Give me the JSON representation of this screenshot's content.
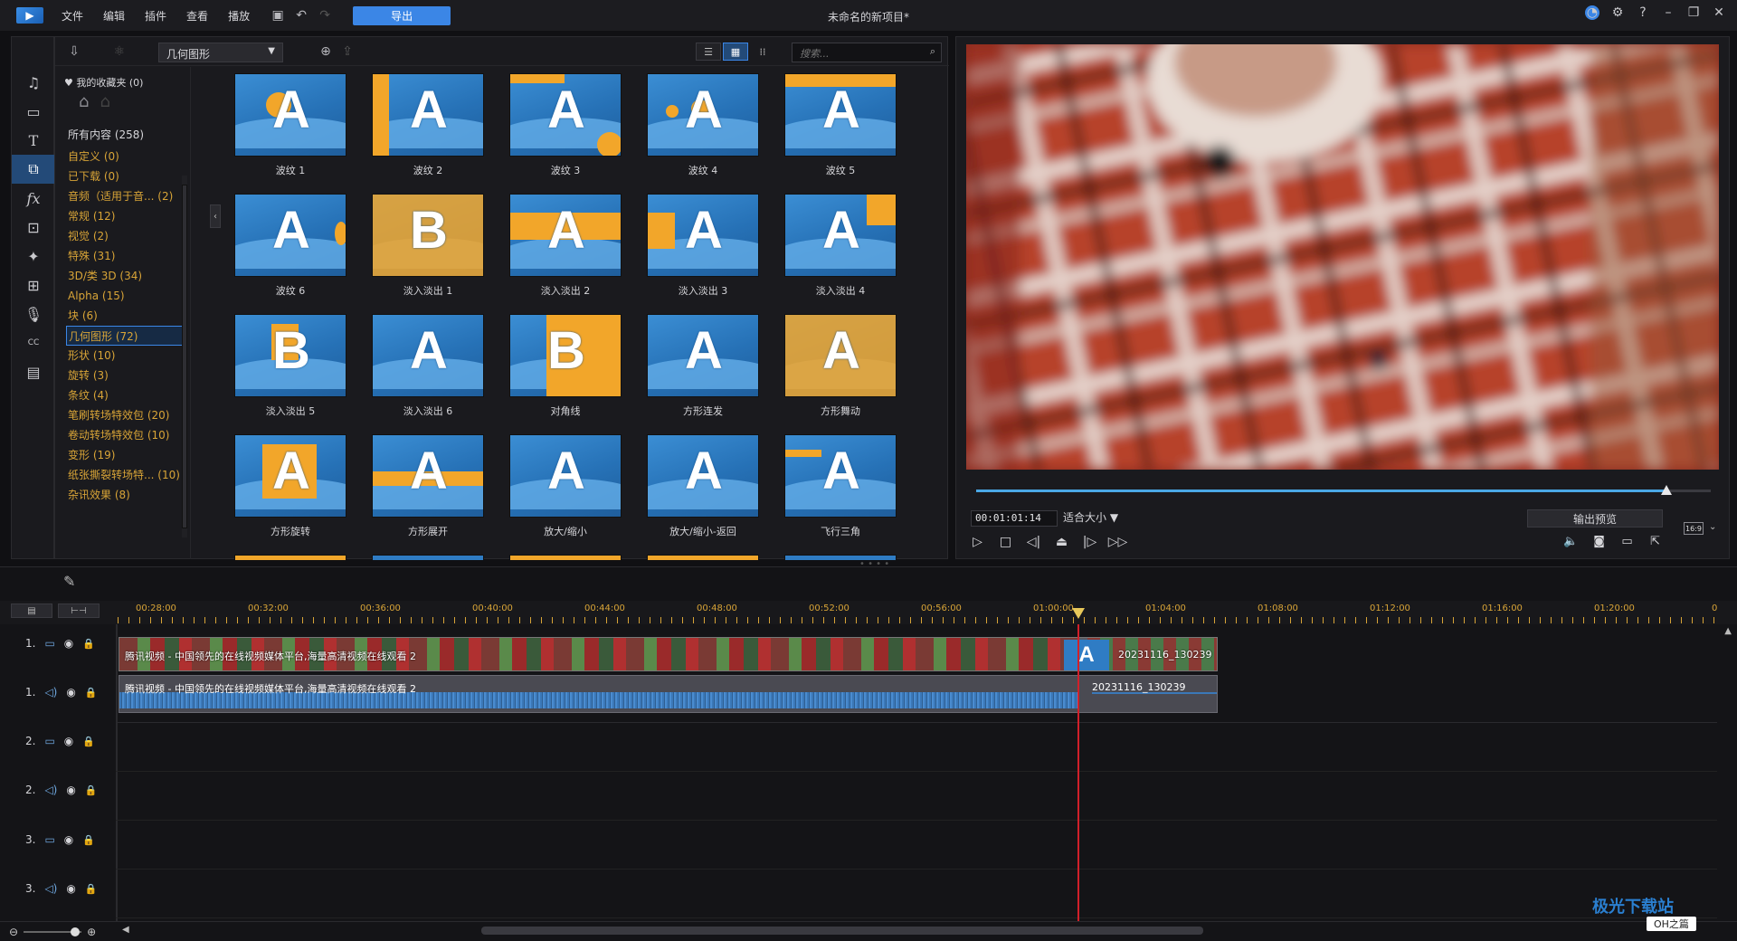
{
  "titlebar": {
    "menu": [
      "文件",
      "编辑",
      "插件",
      "查看",
      "播放"
    ],
    "export_label": "导出",
    "project_title": "未命名的新项目*",
    "accent": "#3b86e6"
  },
  "left_tools": [
    "media-icon",
    "video-icon",
    "title-icon",
    "transition-icon",
    "fx-icon",
    "pip-icon",
    "particle-icon",
    "audio-mixer-icon",
    "voice-icon",
    "subtitle-icon",
    "chapter-icon"
  ],
  "library": {
    "dropdown_value": "几何图形",
    "search_placeholder": "搜索...",
    "favorites_label": "我的收藏夹 (0)",
    "all_label": "所有内容 (258)",
    "categories": [
      {
        "label": "自定义 (0)"
      },
      {
        "label": "已下载 (0)"
      },
      {
        "label": "音频（适用于音... (2)"
      },
      {
        "label": "常规 (12)"
      },
      {
        "label": "视觉 (2)"
      },
      {
        "label": "特殊 (31)"
      },
      {
        "label": "3D/类 3D (34)"
      },
      {
        "label": "Alpha (15)"
      },
      {
        "label": "块 (6)"
      },
      {
        "label": "几何图形 (72)"
      },
      {
        "label": "形状 (10)"
      },
      {
        "label": "旋转 (3)"
      },
      {
        "label": "条纹 (4)"
      },
      {
        "label": "笔刷转场特效包 (20)"
      },
      {
        "label": "卷动转场特效包 (10)"
      },
      {
        "label": "变形 (19)"
      },
      {
        "label": "纸张撕裂转场特... (10)"
      },
      {
        "label": "杂讯效果 (8)"
      }
    ],
    "selected_category": "几何图形 (72)",
    "tiles": [
      {
        "caption": "波纹 1",
        "letter": "A"
      },
      {
        "caption": "波纹 2",
        "letter": "A"
      },
      {
        "caption": "波纹 3",
        "letter": "A"
      },
      {
        "caption": "波纹 4",
        "letter": "A"
      },
      {
        "caption": "波纹 5",
        "letter": "A"
      },
      {
        "caption": "波纹 6",
        "letter": "A"
      },
      {
        "caption": "淡入淡出 1",
        "letter": "B"
      },
      {
        "caption": "淡入淡出 2",
        "letter": "A"
      },
      {
        "caption": "淡入淡出 3",
        "letter": "A"
      },
      {
        "caption": "淡入淡出 4",
        "letter": "A"
      },
      {
        "caption": "淡入淡出 5",
        "letter": "B"
      },
      {
        "caption": "淡入淡出 6",
        "letter": "A"
      },
      {
        "caption": "对角线",
        "letter": "B"
      },
      {
        "caption": "方形连发",
        "letter": "A"
      },
      {
        "caption": "方形舞动",
        "letter": "A"
      },
      {
        "caption": "方形旋转",
        "letter": "A"
      },
      {
        "caption": "方形展开",
        "letter": "A"
      },
      {
        "caption": "放大/缩小",
        "letter": "A"
      },
      {
        "caption": "放大/缩小-返回",
        "letter": "A"
      },
      {
        "caption": "飞行三角",
        "letter": "A"
      }
    ]
  },
  "preview": {
    "timecode": "00:01:01:14",
    "fit_label": "适合大小 ▼",
    "output_preview_label": "输出预览",
    "aspect_ratio": "16:9",
    "progress_fraction": 0.94
  },
  "timeline": {
    "ruler_labels": [
      "00:28:00",
      "00:32:00",
      "00:36:00",
      "00:40:00",
      "00:44:00",
      "00:48:00",
      "00:52:00",
      "00:56:00",
      "01:00:00",
      "01:04:00",
      "01:08:00",
      "01:12:00",
      "01:16:00",
      "01:20:00",
      "0"
    ],
    "tracks": [
      {
        "label": "1.",
        "type": "video"
      },
      {
        "label": "1.",
        "type": "audio"
      },
      {
        "label": "2.",
        "type": "video"
      },
      {
        "label": "2.",
        "type": "audio"
      },
      {
        "label": "3.",
        "type": "video"
      },
      {
        "label": "3.",
        "type": "audio"
      }
    ],
    "clip1_title": "腾讯视频 - 中国领先的在线视频媒体平台,海量高清视频在线观看 2",
    "clip2_title": "20231116_130239",
    "audio1_title": "腾讯视频 - 中国领先的在线视频媒体平台,海量高清视频在线观看 2",
    "audio2_title": "20231116_130239",
    "transition_letter": "A"
  },
  "watermark": {
    "text": "极光下载站",
    "sub": "OH之篇"
  }
}
